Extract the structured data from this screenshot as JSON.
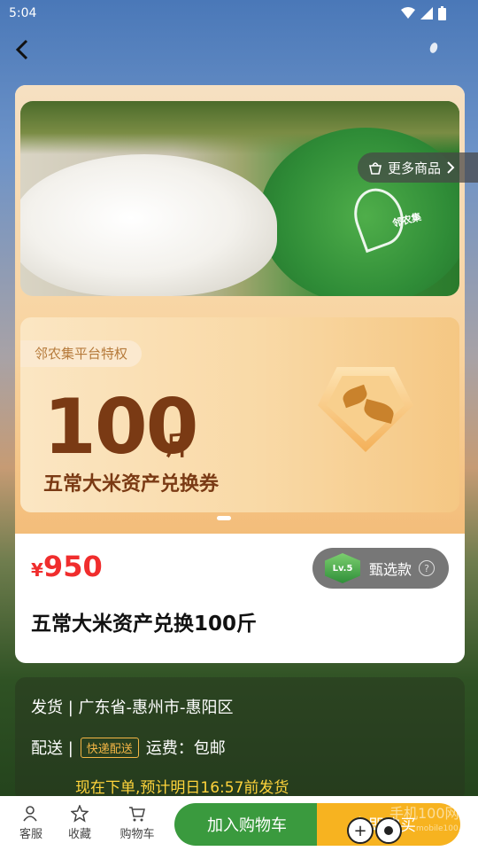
{
  "status_bar": {
    "time": "5:04"
  },
  "banner": {
    "more_products": "更多商品",
    "logo_text": "邻农集",
    "privilege_tag": "邻农集平台特权",
    "amount": "100",
    "unit": "斤",
    "subtitle": "五常大米资产兑换券"
  },
  "product": {
    "currency": "¥",
    "price": "950",
    "selection_label": "甄选款",
    "level_badge": "Lv.5",
    "title": "五常大米资产兑换100斤"
  },
  "shipping": {
    "origin": "发货 | 广东省-惠州市-惠阳区",
    "delivery_prefix": "配送 |",
    "delivery_method": "快递配送",
    "fee": "运费：包邮",
    "estimate": "现在下单,预计明日16:57前发货"
  },
  "bottom_bar": {
    "service": "客服",
    "favorite": "收藏",
    "cart": "购物车",
    "add_to_cart": "加入购物车",
    "buy_now": "立即购买",
    "watermark": "手机100网",
    "watermark_sub": "mobile100.com"
  },
  "colors": {
    "price": "#f02d2d",
    "cart_button": "#3a9a3e",
    "buy_button": "#f7b320"
  }
}
